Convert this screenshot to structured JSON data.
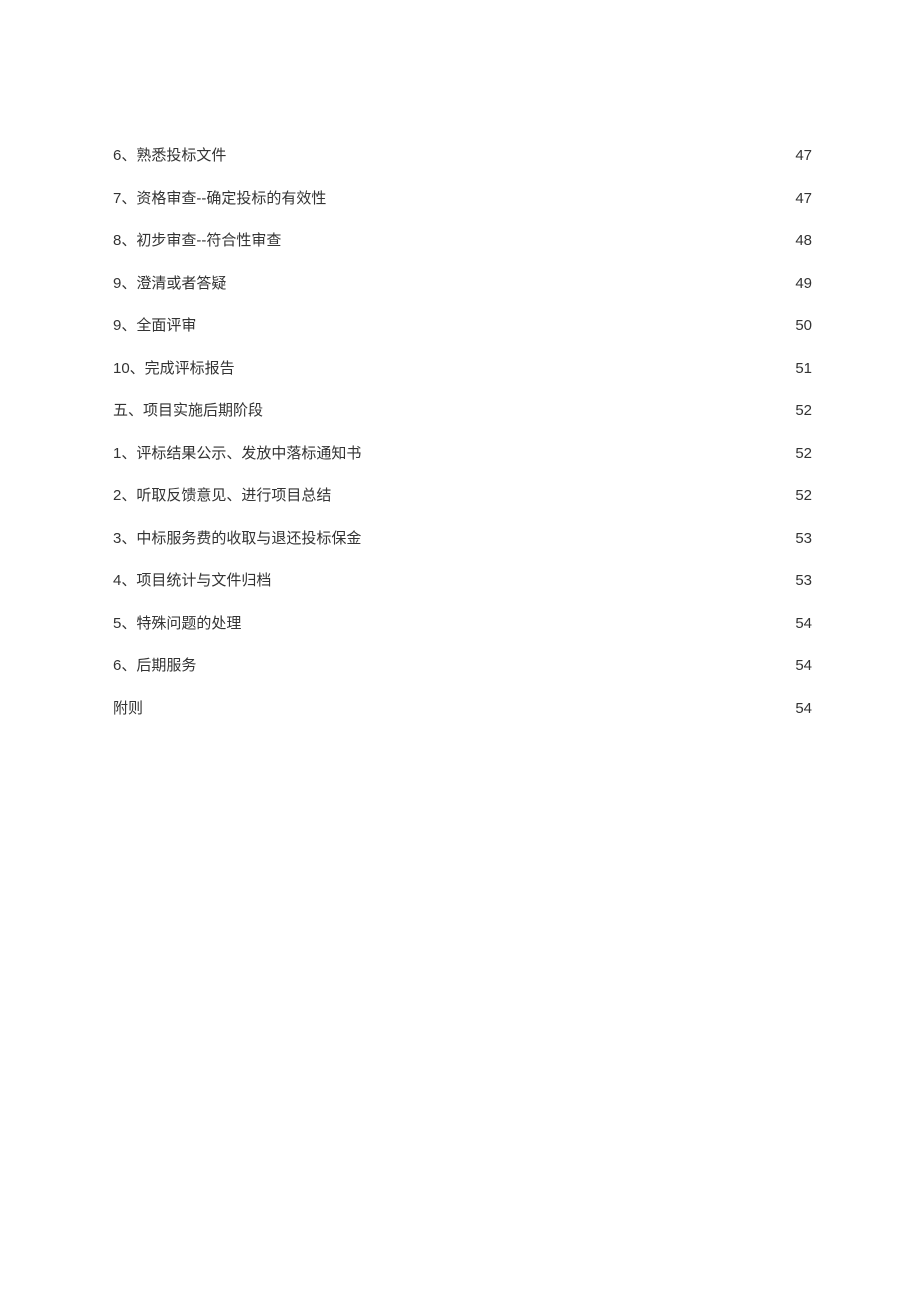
{
  "toc": {
    "entries": [
      {
        "title": "6、熟悉投标文件",
        "page": "47"
      },
      {
        "title": "7、资格审查--确定投标的有效性",
        "page": "47"
      },
      {
        "title": "8、初步审查--符合性审查",
        "page": "48"
      },
      {
        "title": "9、澄清或者答疑",
        "page": "49"
      },
      {
        "title": "9、全面评审",
        "page": "50"
      },
      {
        "title": "10、完成评标报告",
        "page": "51"
      },
      {
        "title": "五、项目实施后期阶段",
        "page": "52"
      },
      {
        "title": "1、评标结果公示、发放中落标通知书",
        "page": "52"
      },
      {
        "title": "2、听取反馈意见、进行项目总结",
        "page": "52"
      },
      {
        "title": "3、中标服务费的收取与退还投标保金",
        "page": "53"
      },
      {
        "title": "4、项目统计与文件归档",
        "page": "53"
      },
      {
        "title": "5、特殊问题的处理",
        "page": "54"
      },
      {
        "title": "6、后期服务",
        "page": "54"
      },
      {
        "title": "附则",
        "page": "54"
      }
    ]
  }
}
